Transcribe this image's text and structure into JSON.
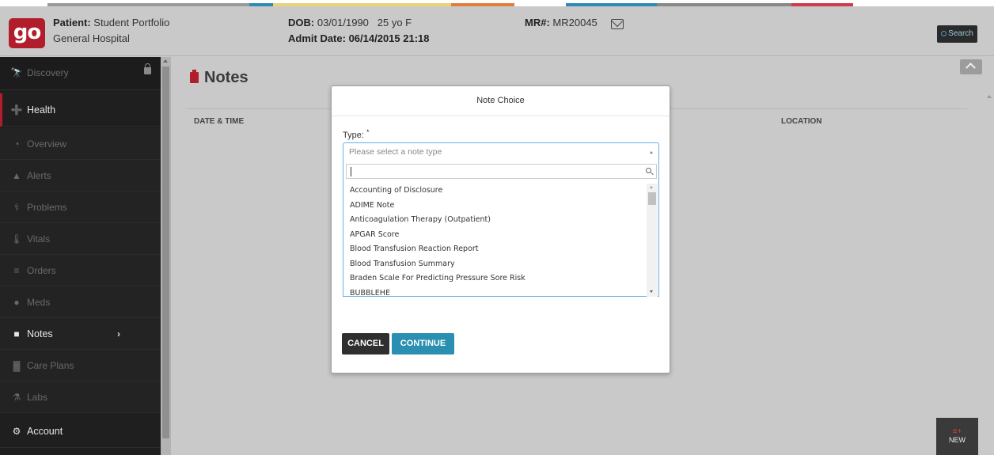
{
  "header": {
    "logo_text": "go",
    "patient_label": "Patient:",
    "patient_name": "Student Portfolio",
    "hospital": "General Hospital",
    "dob_label": "DOB:",
    "dob_value": "03/01/1990   25 yo F",
    "admit_label": "Admit Date:",
    "admit_value": "06/14/2015 21:18",
    "mr_label": "MR#:",
    "mr_value": "MR20045",
    "search_label": "Search"
  },
  "sidebar": {
    "items": [
      {
        "label": "Discovery",
        "icon": "binoculars-icon"
      },
      {
        "label": "Health",
        "icon": "medical-kit-icon"
      },
      {
        "label": "Overview",
        "icon": "gauge-icon"
      },
      {
        "label": "Alerts",
        "icon": "warning-icon"
      },
      {
        "label": "Problems",
        "icon": "stethoscope-icon"
      },
      {
        "label": "Vitals",
        "icon": "thermometer-icon"
      },
      {
        "label": "Orders",
        "icon": "list-icon"
      },
      {
        "label": "Meds",
        "icon": "pills-icon"
      },
      {
        "label": "Notes",
        "icon": "clipboard-icon"
      },
      {
        "label": "Care Plans",
        "icon": "people-icon"
      },
      {
        "label": "Labs",
        "icon": "flask-icon"
      },
      {
        "label": "Account",
        "icon": "cogs-icon"
      }
    ]
  },
  "main": {
    "title": "Notes",
    "columns": [
      "DATE & TIME",
      "LOCATION"
    ],
    "new_button": "NEW"
  },
  "modal": {
    "title": "Note Choice",
    "type_label": "Type:",
    "required_mark": "*",
    "select_placeholder": "Please select a note type",
    "options": [
      "Accounting of Disclosure",
      "ADIME Note",
      "Anticoagulation Therapy (Outpatient)",
      "APGAR Score",
      "Blood Transfusion Reaction Report",
      "Blood Transfusion Summary",
      "Braden Scale For Predicting Pressure Sore Risk",
      "BUBBLEHE"
    ],
    "cancel_label": "CANCEL",
    "continue_label": "CONTINUE"
  },
  "colors": {
    "brand_red": "#b21d2b",
    "accent_blue": "#2a8fb0",
    "sidebar_bg": "#1f1f1f"
  }
}
